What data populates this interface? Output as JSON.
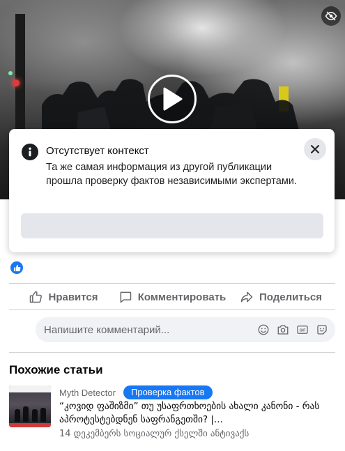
{
  "video": {
    "badge_icon": "eye-slash-icon",
    "play_icon": "play-icon"
  },
  "context_card": {
    "icon": "info-icon",
    "title": "Отсутствует контекст",
    "body": "Та же самая информация из другой публикации прошла проверку фактов независимыми экспертами.",
    "close_icon": "close-icon"
  },
  "reactions": {
    "icon": "like-icon"
  },
  "actions": {
    "like_label": "Нравится",
    "comment_label": "Комментировать",
    "share_label": "Поделиться"
  },
  "composer": {
    "placeholder": "Напишите комментарий...",
    "tools": [
      "emoji-icon",
      "camera-icon",
      "gif-icon",
      "sticker-icon"
    ],
    "gif_text": "GIF"
  },
  "related": {
    "title": "Похожие статьи",
    "articles": [
      {
        "source": "Myth Detector",
        "badge": "Проверка фактов",
        "headline": "“კოვიდ ფაშიზმი” თუ უსაფრთხოების ახალი კანონი - რას აპროტესტებდნენ საფრანგეთში? |...",
        "meta": "14 დეკემბერს სოციალურ ქსელში ანტივაქს"
      }
    ]
  },
  "colors": {
    "accent": "#1877f2",
    "secondary_text": "#65676b",
    "divider": "#ced0d4",
    "card_button": "#e4e6eb"
  }
}
